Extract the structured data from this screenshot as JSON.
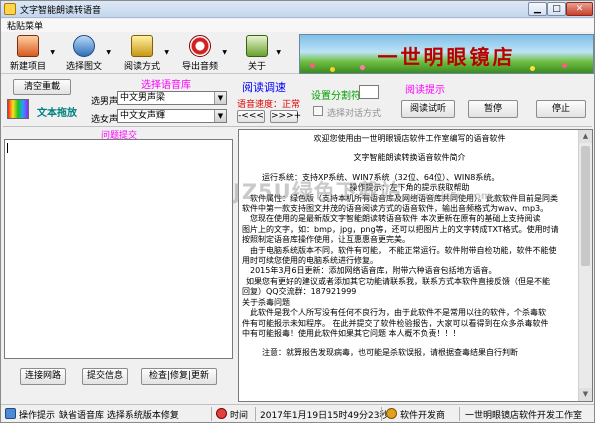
{
  "window": {
    "title": "文字智能朗读转语音",
    "min_glyph": "▁",
    "max_glyph": "□",
    "close_glyph": "✕"
  },
  "menu": {
    "item": "粘贴菜单"
  },
  "toolbar": {
    "items": [
      {
        "label": "新建项目",
        "icon": "new-project-icon"
      },
      {
        "label": "选择图文",
        "icon": "select-image-icon"
      },
      {
        "label": "阅读方式",
        "icon": "read-mode-icon"
      },
      {
        "label": "导出音频",
        "icon": "export-audio-icon"
      },
      {
        "label": "关于",
        "icon": "about-icon"
      }
    ],
    "dropdown_glyph": "▼"
  },
  "banner": {
    "text": "一世明眼镜店"
  },
  "controls": {
    "clear_button": "清空重載",
    "drag_label": "文本拖放",
    "voice_lib_title": "选择语音库",
    "male_label": "选男声",
    "male_value": "中文男声梁",
    "female_label": "选女声",
    "female_value": "中文女声輝",
    "speed_title": "阅读调速",
    "speed_label": "语音速度：正常",
    "speed_down": "-<<<",
    "speed_up": ">>>+",
    "split_label": "设置分割符",
    "auto_mode_label": "选择对话方式",
    "tip_title": "阅读提示",
    "read_test_button": "阅读试听",
    "pause_button": "暂停",
    "stop_button": "停止",
    "dd_glyph": "▼"
  },
  "left_panel": {
    "title": "问题提交",
    "connect_button": "连接网路",
    "submit_button": "提交信息",
    "check_button": "检查|修复|更新"
  },
  "content": {
    "lines": [
      "欢迎您使用由一世明眼镜店软件工作室编写的语音软件",
      "",
      "文字智能朗读转换语音软件简介",
      "",
      "运行系统：支持XP系统、WIN7系统（32位、64位）、WIN8系统。",
      "操作提示：左下角的提示获取帮助",
      "软件属性：绿色版（支持本机所有语音库及网络语音库共同使用）。此款软件目前是同类",
      "软件中第一款支持图文并茂的语音阅读方式的语音软件，输出音频格式为wav、mp3。",
      "您现在使用的是最新版文字智能朗读转语音软件  本次更新在原有的基础上支持阅读",
      "图片上的文字，如：bmp，jpg，png等，还可以把图片上的文字转成TXT格式。使用时请",
      "按照制定语音库操作使用，让互惠惠音更完美。",
      "由于电脑系统版本不同，软件有可能，  不能正常运行。软件附带自检功能，软件不能使",
      "用时可续您使用的电脑系统进行修复。",
      "2015年3月6日更新：添加网络语音库，附带六种语音包括地方语音。",
      "如果您有更好的建议或者添加其它功能请联系我，联系方式本软件直接反馈（但是不能",
      "回复）QQ交流群：187921999",
      "关于杀毒问题",
      "此软件是我个人所写没有任何不良行为，由于此软件不是常用以往的软件，个杀毒软",
      "件有可能报示未知程序。  在此并提交了软件检验报告，大家可以看得到在众多杀毒软件",
      "中有可能报毒！使用此软件如果其它问题   本人概不负责！！！",
      "",
      "注意：就算报告发现病毒，也可能是杀软误报，请根据查毒结果自行判断"
    ],
    "watermark": "JZ5U绿色下载站",
    "watermark_small": "www.jz5u.com"
  },
  "scrollbar": {
    "up_glyph": "▲",
    "down_glyph": "▼"
  },
  "statusbar": {
    "tip_label": "操作提示",
    "tip_text": "缺省语音库  选择系统版本修复",
    "time_label": "时间",
    "time_value": "2017年1月19日15时49分23秒",
    "dev_label": "软件开发商",
    "dev_value": "一世明眼镜店软件开发工作室"
  }
}
